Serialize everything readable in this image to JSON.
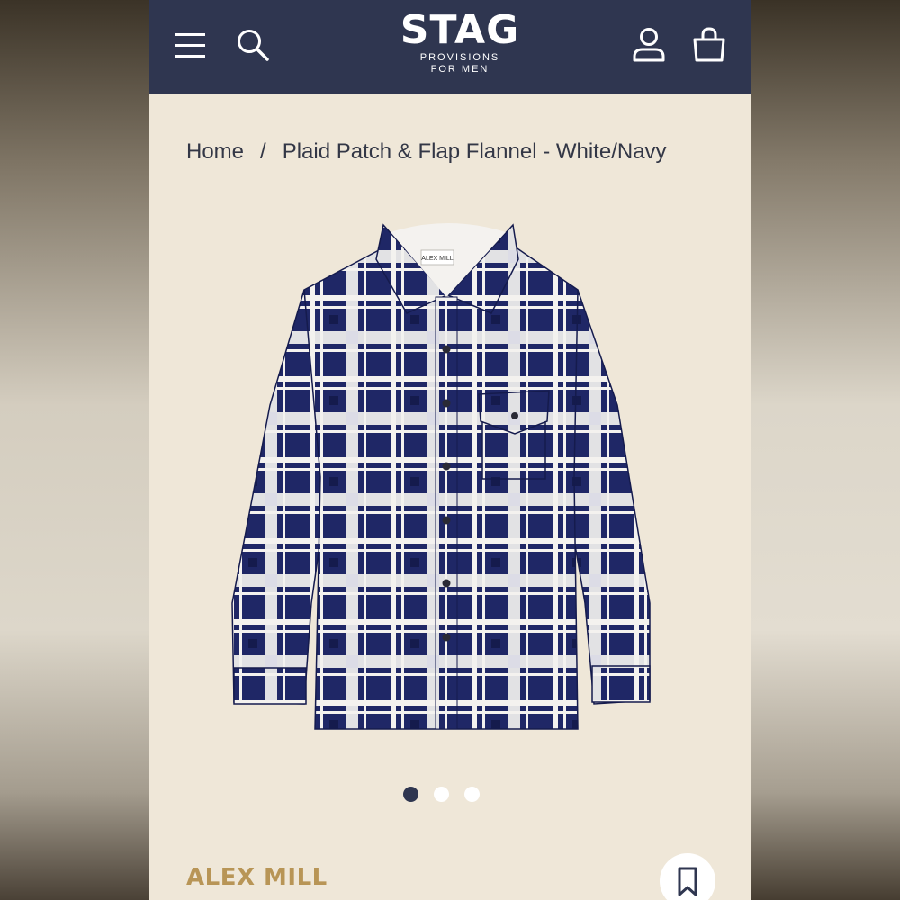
{
  "header": {
    "logo_main": "STAG",
    "logo_sub1": "PROVISIONS",
    "logo_sub2": "FOR MEN",
    "icons": [
      "menu-icon",
      "search-icon",
      "account-icon",
      "bag-icon"
    ]
  },
  "breadcrumb": {
    "home": "Home",
    "separator": "/",
    "current": "Plaid Patch & Flap Flannel - White/Navy"
  },
  "product": {
    "image_label": "ALEX MILL",
    "brand": "ALEX MILL"
  },
  "carousel": {
    "dot_count": 3,
    "active_index": 0
  },
  "colors": {
    "header_bg": "#2f3650",
    "page_bg": "#efe7d8",
    "brand_gold": "#b89556",
    "shirt_navy": "#1f2766",
    "shirt_white": "#f4f2ef"
  }
}
